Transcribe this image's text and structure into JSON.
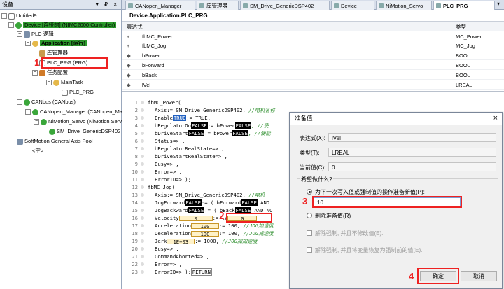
{
  "left_panel": {
    "title": "设备",
    "controls": "▾ ₽ ×",
    "tree": [
      {
        "id": "untitled9",
        "label": "Untitled9"
      },
      {
        "id": "device",
        "label": "Device [连接的] (NIMC2000 Controller)"
      },
      {
        "id": "plc-logic",
        "label": "PLC 逻辑"
      },
      {
        "id": "application",
        "label": "Application [运行]"
      },
      {
        "id": "library-manager",
        "label": "库管理器"
      },
      {
        "id": "plc-prg",
        "label": "PLC_PRG (PRG)"
      },
      {
        "id": "task-config",
        "label": "任务配置"
      },
      {
        "id": "main-task",
        "label": "MainTask"
      },
      {
        "id": "plc-prg-task",
        "label": "PLC_PRG"
      },
      {
        "id": "canbus",
        "label": "CANbus (CANbus)"
      },
      {
        "id": "canopen-manager",
        "label": "CANopen_Manager (CANopen_Manager)"
      },
      {
        "id": "nimotion-servo",
        "label": "NiMotion_Servo (NiMotion Servo)"
      },
      {
        "id": "sm-drive",
        "label": "SM_Drive_GenericDSP402 (SM_Drive_GenericDSP402)"
      },
      {
        "id": "softmotion-pool",
        "label": "SoftMotion General Axis Pool"
      },
      {
        "id": "empty",
        "label": "<空>"
      }
    ]
  },
  "tabs": [
    {
      "label": "CANopen_Manager"
    },
    {
      "label": "库管理器"
    },
    {
      "label": "SM_Drive_GenericDSP402"
    },
    {
      "label": "Device"
    },
    {
      "label": "NiMotion_Servo"
    },
    {
      "label": "PLC_PRG"
    }
  ],
  "tab_close": "▾",
  "path": "Device.Application.PLC_PRG",
  "var_table": {
    "headers": {
      "expr": "表达式",
      "type": "类型"
    },
    "rows": [
      {
        "name": "fbMC_Power",
        "type": "MC_Power"
      },
      {
        "name": "fbMC_Jog",
        "type": "MC_Jog"
      },
      {
        "name": "bPower",
        "type": "BOOL"
      },
      {
        "name": "bForward",
        "type": "BOOL"
      },
      {
        "name": "bBack",
        "type": "BOOL"
      },
      {
        "name": "lVel",
        "type": "LREAL"
      }
    ]
  },
  "code": {
    "line_numbers": [
      "1",
      "2",
      "3",
      "4",
      "5",
      "6",
      "7",
      "8",
      "9",
      "10",
      "11",
      "12",
      "13",
      "14",
      "15",
      "16",
      "17",
      "18",
      "19",
      "20",
      "21",
      "22",
      "23"
    ],
    "l1": "fbMC_Power(",
    "l2a": "Axis:= SM_Drive_GenericDSP402, ",
    "l2c": "//电机名称",
    "l3a": "Enable",
    "l3v": "TRUE",
    "l3b": ":= TRUE,",
    "l4a": "bRegulatorOn",
    "l4v": "FALSE",
    "l4b": ":= bPower",
    "l4v2": "FALSE",
    "l4c": ", //使",
    "l5a": "bDriveStart",
    "l5v": "FALSE",
    "l5b": ":= bPower",
    "l5v2": "FALSE",
    "l5c": ", //使能",
    "l6": "Status=> ,",
    "l7": "bRegulatorRealState=> ,",
    "l8": "bDriveStartRealState=> ,",
    "l9": "Busy=> ,",
    "l10": "Error=> ,",
    "l11": "ErrorID=> );",
    "l12": "fbMC_Jog(",
    "l13a": "Axis:= SM_Drive_GenericDSP402, ",
    "l13c": "//电机",
    "l14a": "JogForward",
    "l14v": "FALSE",
    "l14b": ":= ( bForward",
    "l14v2": "FALSE",
    "l14c": " AND",
    "l15a": "JogBackward",
    "l15v": "FALSE",
    "l15b": ":= ( bBack",
    "l15v2": "FALSE",
    "l15c": " AND NO",
    "l16a": "Velocity",
    "l16v": "0",
    "l16b": ":= lV",
    "l16v2": "0",
    "l17a": "Acceleration",
    "l17v": "100",
    "l17b": ":= 100, ",
    "l17c": "//JOG加速度",
    "l18a": "Deceleration",
    "l18v": "100",
    "l18b": ":= 100, ",
    "l18c": "//JOG减速度",
    "l19a": "Jerk",
    "l19v": "1E+03",
    "l19b": ":= 1000, ",
    "l19c": "//JOG加加速度",
    "l20": "Busy=> ,",
    "l21": "CommandAborted=> ,",
    "l22": "Error=> ,",
    "l23a": "ErrorID=> );",
    "l23r": "RETURN"
  },
  "dialog": {
    "title": "准备值",
    "close": "×",
    "expr_label": "表达式(X):",
    "expr_value": "lVel",
    "type_label": "类型(T):",
    "type_value": "LREAL",
    "current_label": "当前值(C):",
    "current_value": "0",
    "question": "希望做什么?",
    "opt_prepare": "为下一次写入值或强制值的操作准备新值(P):",
    "new_value": "10",
    "opt_delete": "删除准备值(R)",
    "opt_release": "解除强制, 并且不修改值(E).",
    "opt_restore": "解除强制, 并且将变量恢复为强制前的值(E).",
    "ok": "确定",
    "cancel": "取消"
  },
  "annotations": [
    "1",
    "2",
    "3",
    "4"
  ],
  "colors": {
    "accent_red": "#e22222",
    "running_green": "#2d9c2d"
  }
}
